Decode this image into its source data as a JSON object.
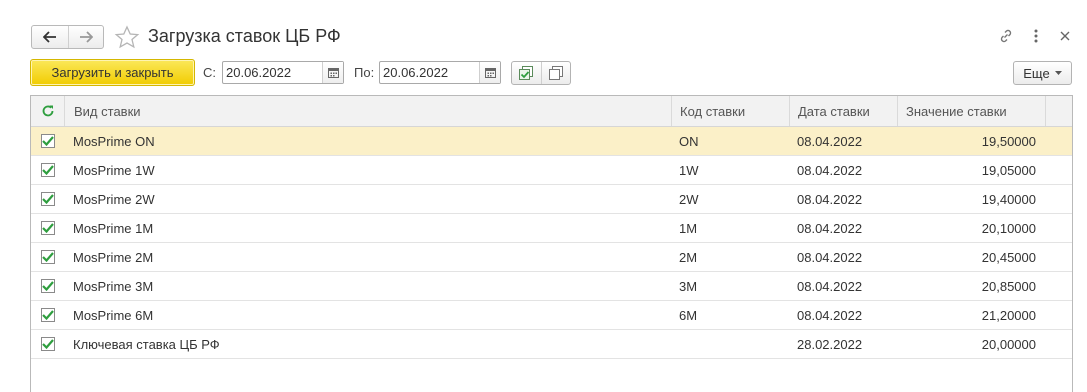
{
  "window": {
    "title": "Загрузка ставок ЦБ РФ"
  },
  "toolbar": {
    "load_close_label": "Загрузить и закрыть",
    "from_label": "С:",
    "from_value": "20.06.2022",
    "to_label": "По:",
    "to_value": "20.06.2022",
    "more_label": "Еще"
  },
  "table": {
    "columns": [
      "Вид ставки",
      "Код ставки",
      "Дата ставки",
      "Значение ставки"
    ],
    "rows": [
      {
        "checked": true,
        "name": "MosPrime ON",
        "code": "ON",
        "date": "08.04.2022",
        "value": "19,50000"
      },
      {
        "checked": true,
        "name": "MosPrime 1W",
        "code": "1W",
        "date": "08.04.2022",
        "value": "19,05000"
      },
      {
        "checked": true,
        "name": "MosPrime 2W",
        "code": "2W",
        "date": "08.04.2022",
        "value": "19,40000"
      },
      {
        "checked": true,
        "name": "MosPrime 1M",
        "code": "1M",
        "date": "08.04.2022",
        "value": "20,10000"
      },
      {
        "checked": true,
        "name": "MosPrime 2M",
        "code": "2M",
        "date": "08.04.2022",
        "value": "20,45000"
      },
      {
        "checked": true,
        "name": "MosPrime 3M",
        "code": "3M",
        "date": "08.04.2022",
        "value": "20,85000"
      },
      {
        "checked": true,
        "name": "MosPrime 6M",
        "code": "6M",
        "date": "08.04.2022",
        "value": "21,20000"
      },
      {
        "checked": true,
        "name": "Ключевая ставка ЦБ РФ",
        "code": "",
        "date": "28.02.2022",
        "value": "20,00000"
      }
    ]
  },
  "colors": {
    "primary_button": "#f5d713",
    "selected_row": "#fbf0c8",
    "check_green": "#2e9e3e"
  }
}
